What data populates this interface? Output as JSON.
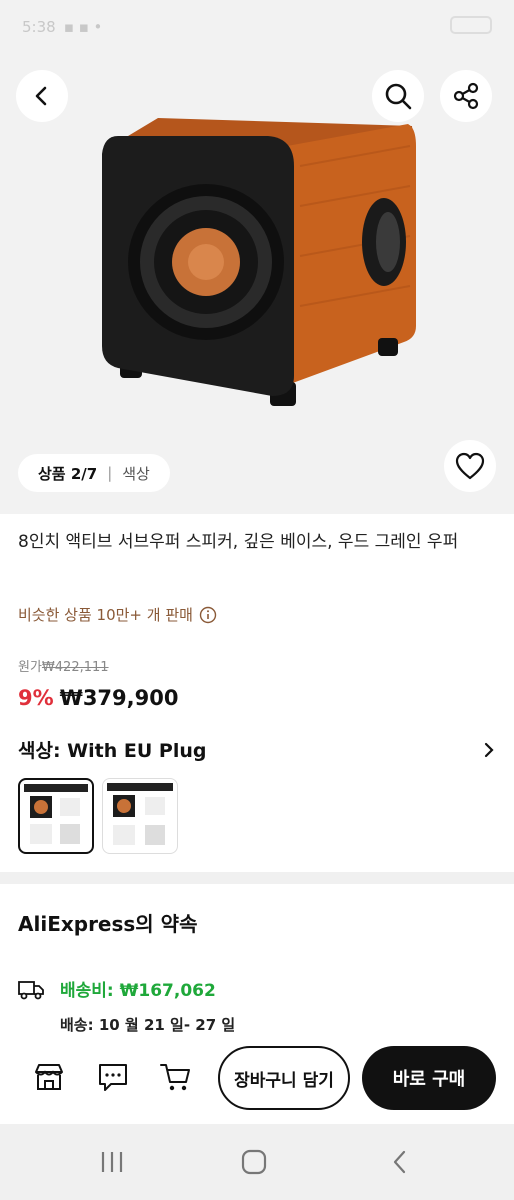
{
  "status": {
    "time": "5:38"
  },
  "product": {
    "image_counter": "상품 2/7",
    "image_tab_color": "색상",
    "title": "8인치 액티브 서브우퍼 스피커, 깊은 베이스, 우드 그레인 우퍼",
    "sold_text": "비슷한 상품 10만+ 개 판매",
    "original_label": "원가",
    "original_price": "₩422,111",
    "discount": "9%",
    "price": "₩379,900",
    "color_label": "색상: With EU Plug"
  },
  "promise": {
    "title": "AliExpress의 약속",
    "shipping_cost": "배송비: ₩167,062",
    "delivery": "배송: 10 월 21 일- 27 일"
  },
  "actions": {
    "add_to_cart": "장바구니 담기",
    "buy_now": "바로 구매"
  },
  "colors": {
    "discount": "#e0303b",
    "shipping": "#1fa83a",
    "sold": "#8a5a38",
    "wood": "#c8621e"
  },
  "icons": [
    "back-icon",
    "search-icon",
    "share-icon",
    "heart-icon",
    "info-icon",
    "chevron-right-icon",
    "truck-icon",
    "store-icon",
    "chat-icon",
    "cart-icon",
    "recents-icon",
    "home-icon",
    "nav-back-icon"
  ]
}
